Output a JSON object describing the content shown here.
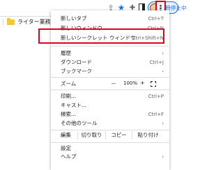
{
  "toolbar": {
    "profile_status": "一時停止中",
    "kebab_icon": "⋮",
    "icons": [
      "share-icon",
      "star-icon",
      "extensions-icon",
      "split-view-icon",
      "avatar",
      "kebab-menu-icon"
    ]
  },
  "bookmarks": {
    "folder_label": "ライター業務"
  },
  "menu": {
    "new_tab": {
      "label": "新しいタブ",
      "shortcut": "Ctrl+T"
    },
    "new_window": {
      "label": "新しいウィンドウ",
      "shortcut": "Ctrl+N"
    },
    "incognito": {
      "label": "新しいシークレット ウィンドウ",
      "shortcut": "Ctrl+Shift+N"
    },
    "history": {
      "label": "履歴"
    },
    "downloads": {
      "label": "ダウンロード",
      "shortcut": "Ctrl+J"
    },
    "bookmarks": {
      "label": "ブックマーク"
    },
    "zoom": {
      "label": "ズーム",
      "minus": "－",
      "value": "100%",
      "plus": "+"
    },
    "print": {
      "label": "印刷...",
      "shortcut": "Ctrl+P"
    },
    "cast": {
      "label": "キャスト..."
    },
    "find": {
      "label": "検索...",
      "shortcut": "Ctrl+F"
    },
    "more_tools": {
      "label": "その他のツール"
    },
    "edit": {
      "label": "編集",
      "cut": "切り取り",
      "copy": "コピー",
      "paste": "貼り付け"
    },
    "settings": {
      "label": "設定"
    },
    "help": {
      "label": "ヘルプ"
    }
  },
  "colors": {
    "highlight": "#e0001b",
    "accent": "#1a73e8"
  }
}
